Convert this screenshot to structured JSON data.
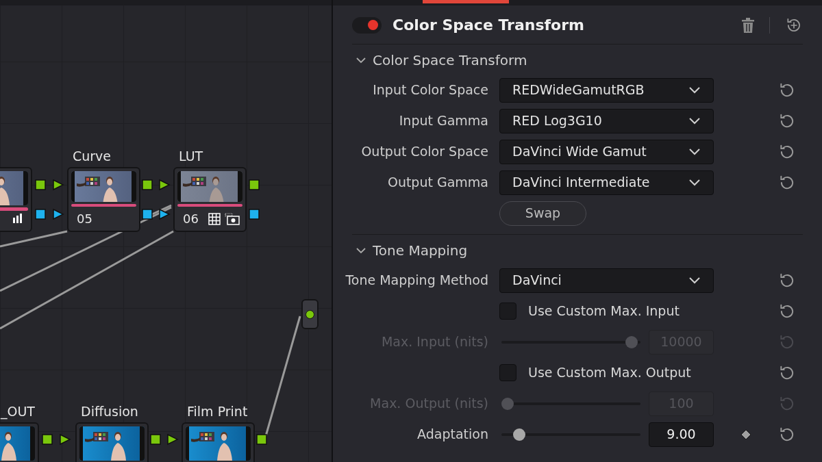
{
  "node_graph": {
    "nodes": [
      {
        "kind": "grey",
        "icons": [
          {
            "kind": "bars"
          }
        ]
      },
      {
        "label": "Curve",
        "number": "05",
        "kind": "grey"
      },
      {
        "label": "LUT",
        "number": "06",
        "kind": "faded",
        "icons": [
          {
            "kind": "grid"
          },
          {
            "kind": "frame"
          }
        ]
      },
      {
        "label": "_OUT",
        "kind": "blue"
      },
      {
        "label": "Diffusion",
        "kind": "blue"
      },
      {
        "label": "Film Print",
        "kind": "blue"
      }
    ]
  },
  "panel": {
    "enabled": true,
    "title": "Color Space Transform",
    "sections": [
      {
        "title": "Color Space Transform",
        "expanded": true,
        "rows": [
          {
            "kind": "dropdown",
            "label": "Input Color Space",
            "value": "REDWideGamutRGB"
          },
          {
            "kind": "dropdown",
            "label": "Input Gamma",
            "value": "RED Log3G10"
          },
          {
            "kind": "dropdown",
            "label": "Output Color Space",
            "value": "DaVinci Wide Gamut"
          },
          {
            "kind": "dropdown",
            "label": "Output Gamma",
            "value": "DaVinci Intermediate"
          },
          {
            "kind": "button",
            "label": "Swap"
          }
        ]
      },
      {
        "title": "Tone Mapping",
        "expanded": true,
        "rows": [
          {
            "kind": "dropdown",
            "label": "Tone Mapping Method",
            "value": "DaVinci"
          },
          {
            "kind": "checkbox",
            "label": "Use Custom Max. Input",
            "checked": false
          },
          {
            "kind": "slider",
            "label": "Max. Input (nits)",
            "level": 0.98,
            "value": "10000",
            "disabled": true
          },
          {
            "kind": "checkbox",
            "label": "Use Custom Max. Output",
            "checked": false
          },
          {
            "kind": "slider",
            "label": "Max. Output (nits)",
            "level": 0.0,
            "value": "100",
            "disabled": true
          },
          {
            "kind": "slider",
            "label": "Adaptation",
            "level": 0.09,
            "value": "9.00",
            "disabled": false,
            "keyframe": true
          }
        ]
      }
    ]
  }
}
